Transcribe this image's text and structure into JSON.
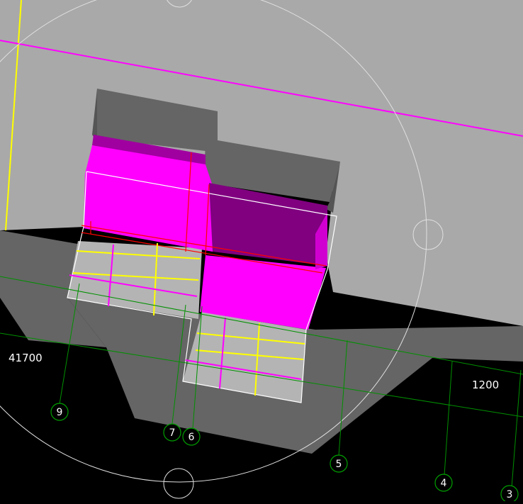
{
  "viewport": {
    "background": "#000000",
    "colors": {
      "slab_top": "#a9a9a9",
      "wall_dark": "#656565",
      "magenta": "#ff00ff",
      "magenta_dark": "#800080",
      "grid_green": "#008a00",
      "yellow": "#ffff00",
      "red": "#ff0000",
      "outline": "#ffffff"
    }
  },
  "dimensions": {
    "left": "41700",
    "right": "1200"
  },
  "grid_axes": [
    {
      "label": "9"
    },
    {
      "label": "7"
    },
    {
      "label": "6"
    },
    {
      "label": "5"
    },
    {
      "label": "4"
    },
    {
      "label": "3"
    }
  ],
  "navigation": {
    "orbit_circle": "orbit-ring",
    "handles": [
      "orbit-handle-top",
      "orbit-handle-right",
      "orbit-handle-bottom"
    ]
  }
}
